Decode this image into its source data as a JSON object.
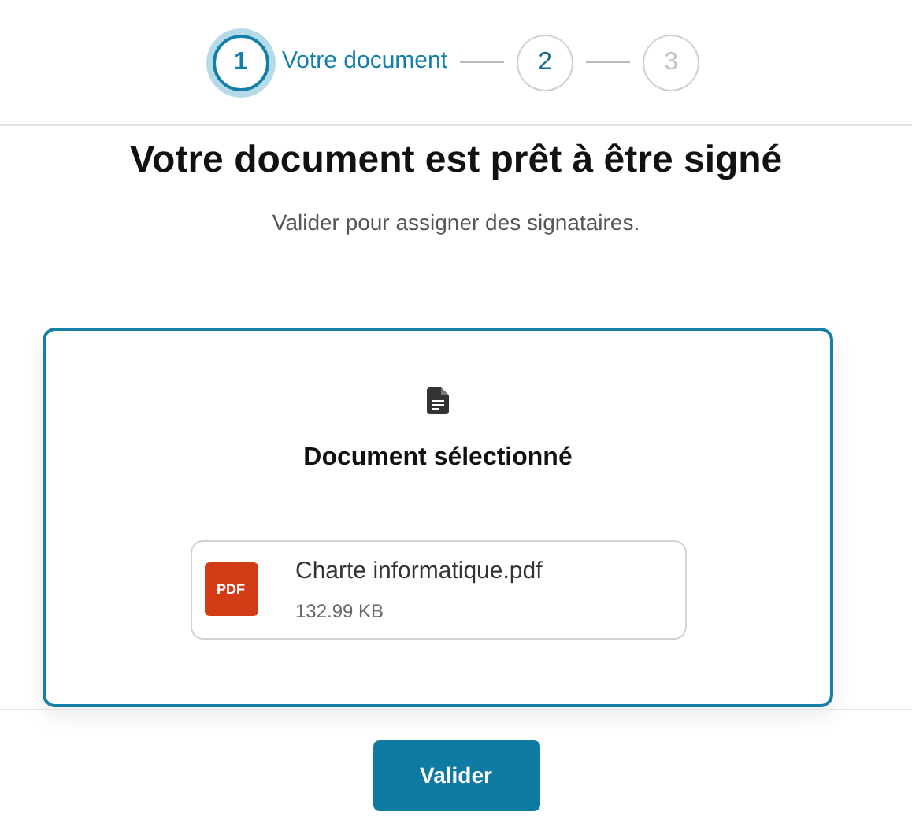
{
  "stepper": [
    {
      "number": "1",
      "label": "Votre document",
      "selected": true,
      "disabled": false
    },
    {
      "number": "2",
      "selected": false,
      "disabled": false
    },
    {
      "number": "3",
      "selected": false,
      "disabled": true
    }
  ],
  "title": "Votre document est prêt à être signé",
  "subtitle": "Valider pour assigner des signataires.",
  "card": {
    "heading": "Document sélectionné",
    "file": {
      "type_label": "PDF",
      "name": "Charte informatique.pdf",
      "size": "132.99 KB"
    }
  },
  "buttons": [
    "Valider"
  ]
}
